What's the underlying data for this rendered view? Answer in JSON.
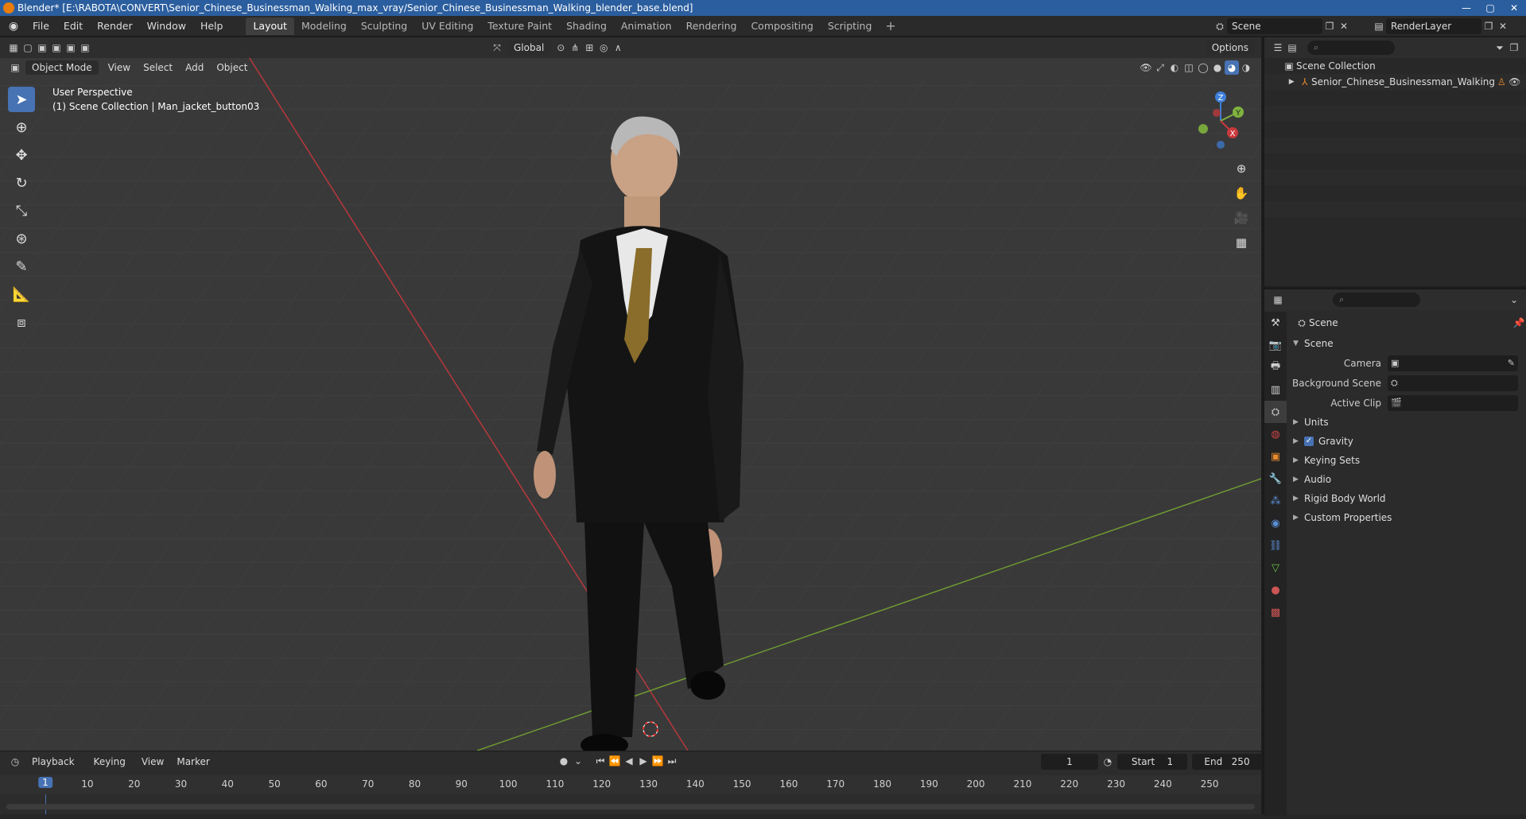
{
  "window": {
    "title": "Blender* [E:\\RABOTA\\CONVERT\\Senior_Chinese_Businessman_Walking_max_vray/Senior_Chinese_Businessman_Walking_blender_base.blend]",
    "minimize": "—",
    "maximize": "▢",
    "close": "✕"
  },
  "menu": {
    "items": [
      "File",
      "Edit",
      "Render",
      "Window",
      "Help"
    ],
    "workspaces": [
      "Layout",
      "Modeling",
      "Sculpting",
      "UV Editing",
      "Texture Paint",
      "Shading",
      "Animation",
      "Rendering",
      "Compositing",
      "Scripting"
    ],
    "active_workspace": "Layout",
    "add_tab": "+",
    "scene": "Scene",
    "view_layer": "RenderLayer"
  },
  "viewport": {
    "mode": "Object Mode",
    "menus": [
      "View",
      "Select",
      "Add",
      "Object"
    ],
    "transform_orientation": "Global",
    "options": "Options",
    "perspective_label": "User Perspective",
    "collection_label": "(1) Scene Collection | Man_jacket_button03",
    "gizmo": {
      "x": "X",
      "y": "Y",
      "z": "Z"
    }
  },
  "timeline": {
    "menus": [
      "Playback",
      "Keying",
      "View",
      "Marker"
    ],
    "current_frame": "1",
    "start_label": "Start",
    "start": "1",
    "end_label": "End",
    "end": "250",
    "ticks": [
      "10",
      "20",
      "30",
      "40",
      "50",
      "60",
      "70",
      "80",
      "90",
      "100",
      "110",
      "120",
      "130",
      "140",
      "150",
      "160",
      "170",
      "180",
      "190",
      "200",
      "210",
      "220",
      "230",
      "240",
      "250"
    ],
    "playhead_label": "1"
  },
  "outliner": {
    "root": "Scene Collection",
    "items": [
      "Senior_Chinese_Businessman_Walking"
    ]
  },
  "properties": {
    "context_title": "Scene",
    "section": "Scene",
    "fields": [
      {
        "label": "Camera",
        "value": ""
      },
      {
        "label": "Background Scene",
        "value": ""
      },
      {
        "label": "Active Clip",
        "value": ""
      }
    ],
    "panels": [
      "Units",
      "Gravity",
      "Keying Sets",
      "Audio",
      "Rigid Body World",
      "Custom Properties"
    ],
    "gravity_checked": true
  },
  "colors": {
    "accent": "#4772b3",
    "titlebar": "#2b5e9e",
    "x_axis": "#c9393d",
    "y_axis": "#7fb33d",
    "z_axis": "#3d7fd9"
  }
}
